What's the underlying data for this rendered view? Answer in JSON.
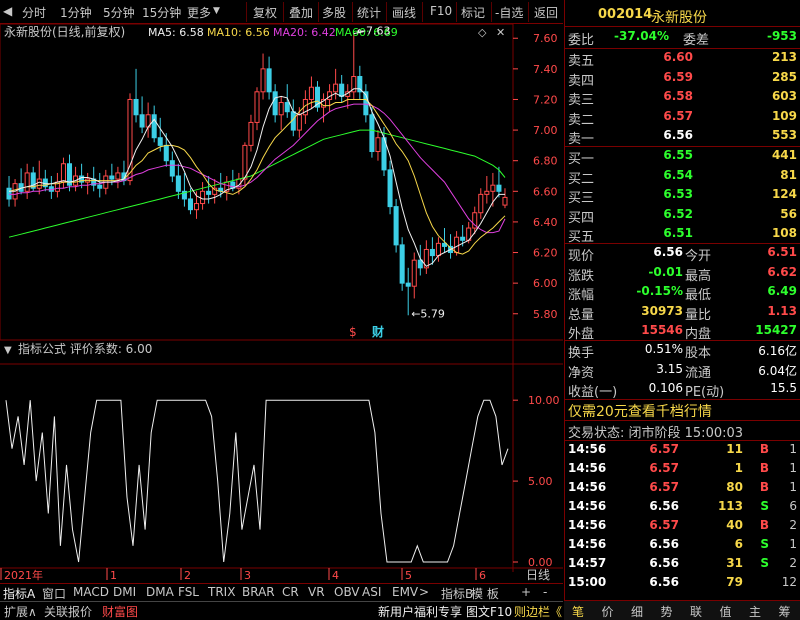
{
  "topbar": {
    "tabs": [
      "分时",
      "1分钟",
      "5分钟",
      "15分钟",
      "更多",
      "复权",
      "叠加",
      "多股",
      "统计",
      "画线",
      "F10",
      "标记",
      "-自选",
      "返回"
    ]
  },
  "chart_header": {
    "title": "永新股份(日线,前复权)",
    "ma5": "MA5: 6.58",
    "ma10": "MA10: 6.56",
    "ma20": "MA20: 6.42",
    "ma60": "MA60: 6.69",
    "high_label": "7.63",
    "low_label": "5.79",
    "fin_marker": "财",
    "dollar_marker": "$"
  },
  "price_axis": [
    "7.60",
    "7.40",
    "7.20",
    "7.00",
    "6.80",
    "6.60",
    "6.40",
    "6.20",
    "6.00",
    "5.80"
  ],
  "indicator": {
    "title": "指标公式 评价系数: 6.00",
    "axis": [
      "10.00",
      "5.00",
      "0.00"
    ]
  },
  "date_axis": {
    "labels": [
      "2021年",
      "1",
      "2",
      "3",
      "4",
      "5",
      "6"
    ],
    "right_label": "日线"
  },
  "bottom_tabs": [
    "指标A",
    "窗口",
    "MACD",
    "DMI",
    "DMA",
    "FSL",
    "TRIX",
    "BRAR",
    "CR",
    "VR",
    "OBV",
    "ASI",
    "EMV",
    ">",
    "指标B",
    "模 板",
    "+",
    "-"
  ],
  "status_bar": {
    "left": [
      "扩展∧",
      "关联报价",
      "财富图"
    ],
    "right": [
      "新用户福利专享",
      "图文F10",
      "则边栏《"
    ]
  },
  "quote": {
    "code": "002014",
    "name": "永新股份",
    "wb_label": "委比",
    "wb_val": "-37.04%",
    "wc_label": "委差",
    "wc_val": "-953",
    "asks": [
      {
        "label": "卖五",
        "price": "6.60",
        "vol": "213"
      },
      {
        "label": "卖四",
        "price": "6.59",
        "vol": "285"
      },
      {
        "label": "卖三",
        "price": "6.58",
        "vol": "603"
      },
      {
        "label": "卖二",
        "price": "6.57",
        "vol": "109"
      },
      {
        "label": "卖一",
        "price": "6.56",
        "vol": "553"
      }
    ],
    "bids": [
      {
        "label": "买一",
        "price": "6.55",
        "vol": "441"
      },
      {
        "label": "买二",
        "price": "6.54",
        "vol": "81"
      },
      {
        "label": "买三",
        "price": "6.53",
        "vol": "124"
      },
      {
        "label": "买四",
        "price": "6.52",
        "vol": "56"
      },
      {
        "label": "买五",
        "price": "6.51",
        "vol": "108"
      }
    ],
    "stats": [
      {
        "l1": "现价",
        "v1": "6.56",
        "l2": "今开",
        "v2": "6.51"
      },
      {
        "l1": "涨跌",
        "v1": "-0.01",
        "l2": "最高",
        "v2": "6.62"
      },
      {
        "l1": "涨幅",
        "v1": "-0.15%",
        "l2": "最低",
        "v2": "6.49"
      },
      {
        "l1": "总量",
        "v1": "30973",
        "l2": "量比",
        "v2": "1.13"
      },
      {
        "l1": "外盘",
        "v1": "15546",
        "l2": "内盘",
        "v2": "15427"
      }
    ],
    "stats2": [
      {
        "l1": "换手",
        "v1": "0.51%",
        "l2": "股本",
        "v2": "6.16亿"
      },
      {
        "l1": "净资",
        "v1": "3.15",
        "l2": "流通",
        "v2": "6.04亿"
      },
      {
        "l1": "收益(一)",
        "v1": "0.106",
        "l2": "PE(动)",
        "v2": "15.5"
      }
    ],
    "promo": "仅需20元查看千档行情",
    "trade_state": "交易状态: 闭市阶段  15:00:03",
    "ticks": [
      {
        "t": "14:56",
        "p": "6.57",
        "v": "11",
        "s": "B",
        "n": "1"
      },
      {
        "t": "14:56",
        "p": "6.57",
        "v": "1",
        "s": "B",
        "n": "1"
      },
      {
        "t": "14:56",
        "p": "6.57",
        "v": "80",
        "s": "B",
        "n": "1"
      },
      {
        "t": "14:56",
        "p": "6.56",
        "v": "113",
        "s": "S",
        "n": "6"
      },
      {
        "t": "14:56",
        "p": "6.57",
        "v": "40",
        "s": "B",
        "n": "2"
      },
      {
        "t": "14:56",
        "p": "6.56",
        "v": "6",
        "s": "S",
        "n": "1"
      },
      {
        "t": "14:57",
        "p": "6.56",
        "v": "31",
        "s": "S",
        "n": "2"
      },
      {
        "t": "15:00",
        "p": "6.56",
        "v": "79",
        "s": "",
        "n": "12"
      }
    ],
    "tabs": [
      "笔",
      "价",
      "细",
      "势",
      "联",
      "值",
      "主",
      "筹"
    ]
  },
  "chart_data": {
    "type": "candlestick",
    "ylim": [
      5.72,
      7.68
    ],
    "ohlc": [
      [
        6.62,
        6.7,
        6.5,
        6.55
      ],
      [
        6.55,
        6.68,
        6.5,
        6.65
      ],
      [
        6.65,
        6.75,
        6.58,
        6.6
      ],
      [
        6.6,
        6.78,
        6.55,
        6.72
      ],
      [
        6.72,
        6.76,
        6.6,
        6.62
      ],
      [
        6.62,
        6.8,
        6.58,
        6.68
      ],
      [
        6.68,
        6.74,
        6.6,
        6.63
      ],
      [
        6.63,
        6.7,
        6.55,
        6.6
      ],
      [
        6.6,
        6.72,
        6.56,
        6.66
      ],
      [
        6.66,
        6.82,
        6.62,
        6.78
      ],
      [
        6.78,
        6.84,
        6.6,
        6.64
      ],
      [
        6.64,
        6.76,
        6.6,
        6.7
      ],
      [
        6.7,
        6.78,
        6.62,
        6.66
      ],
      [
        6.66,
        6.72,
        6.58,
        6.68
      ],
      [
        6.68,
        6.76,
        6.6,
        6.64
      ],
      [
        6.64,
        6.72,
        6.56,
        6.62
      ],
      [
        6.62,
        6.74,
        6.58,
        6.7
      ],
      [
        6.7,
        6.78,
        6.64,
        6.68
      ],
      [
        6.68,
        6.76,
        6.62,
        6.72
      ],
      [
        6.72,
        6.8,
        6.64,
        6.67
      ],
      [
        6.67,
        7.24,
        6.64,
        7.2
      ],
      [
        7.2,
        7.4,
        7.05,
        7.1
      ],
      [
        7.1,
        7.22,
        6.98,
        7.02
      ],
      [
        7.02,
        7.18,
        6.95,
        7.1
      ],
      [
        7.1,
        7.16,
        6.92,
        6.95
      ],
      [
        6.95,
        7.08,
        6.86,
        6.9
      ],
      [
        6.9,
        6.98,
        6.76,
        6.8
      ],
      [
        6.8,
        6.86,
        6.66,
        6.7
      ],
      [
        6.7,
        6.78,
        6.55,
        6.6
      ],
      [
        6.6,
        6.72,
        6.5,
        6.55
      ],
      [
        6.55,
        6.62,
        6.45,
        6.48
      ],
      [
        6.48,
        6.6,
        6.42,
        6.52
      ],
      [
        6.52,
        6.66,
        6.48,
        6.6
      ],
      [
        6.6,
        6.7,
        6.52,
        6.58
      ],
      [
        6.58,
        6.68,
        6.52,
        6.62
      ],
      [
        6.62,
        6.72,
        6.56,
        6.6
      ],
      [
        6.6,
        6.7,
        6.54,
        6.66
      ],
      [
        6.66,
        6.74,
        6.6,
        6.62
      ],
      [
        6.62,
        6.72,
        6.58,
        6.68
      ],
      [
        6.68,
        6.92,
        6.64,
        6.9
      ],
      [
        6.9,
        7.1,
        6.86,
        7.05
      ],
      [
        7.05,
        7.28,
        7.0,
        7.25
      ],
      [
        7.25,
        7.5,
        7.2,
        7.4
      ],
      [
        7.4,
        7.48,
        7.2,
        7.25
      ],
      [
        7.25,
        7.3,
        7.05,
        7.1
      ],
      [
        7.1,
        7.22,
        7.0,
        7.18
      ],
      [
        7.18,
        7.3,
        7.08,
        7.12
      ],
      [
        7.12,
        7.2,
        6.96,
        7.0
      ],
      [
        7.0,
        7.15,
        6.95,
        7.1
      ],
      [
        7.1,
        7.26,
        7.04,
        7.2
      ],
      [
        7.2,
        7.35,
        7.14,
        7.28
      ],
      [
        7.28,
        7.32,
        7.12,
        7.15
      ],
      [
        7.15,
        7.24,
        7.05,
        7.2
      ],
      [
        7.2,
        7.3,
        7.12,
        7.25
      ],
      [
        7.25,
        7.4,
        7.2,
        7.3
      ],
      [
        7.3,
        7.36,
        7.18,
        7.22
      ],
      [
        7.22,
        7.3,
        7.14,
        7.25
      ],
      [
        7.25,
        7.63,
        7.2,
        7.35
      ],
      [
        7.35,
        7.42,
        7.2,
        7.25
      ],
      [
        7.25,
        7.3,
        7.05,
        7.1
      ],
      [
        7.1,
        7.15,
        6.82,
        6.86
      ],
      [
        6.86,
        7.0,
        6.8,
        6.95
      ],
      [
        6.95,
        7.02,
        6.7,
        6.74
      ],
      [
        6.74,
        6.8,
        6.45,
        6.5
      ],
      [
        6.5,
        6.55,
        6.2,
        6.25
      ],
      [
        6.25,
        6.3,
        5.95,
        6.0
      ],
      [
        6.0,
        6.1,
        5.79,
        5.98
      ],
      [
        5.98,
        6.2,
        5.9,
        6.15
      ],
      [
        6.15,
        6.25,
        6.05,
        6.1
      ],
      [
        6.1,
        6.28,
        6.06,
        6.22
      ],
      [
        6.22,
        6.3,
        6.12,
        6.18
      ],
      [
        6.18,
        6.3,
        6.14,
        6.26
      ],
      [
        6.26,
        6.36,
        6.2,
        6.24
      ],
      [
        6.24,
        6.32,
        6.16,
        6.2
      ],
      [
        6.2,
        6.34,
        6.18,
        6.3
      ],
      [
        6.3,
        6.38,
        6.24,
        6.28
      ],
      [
        6.28,
        6.4,
        6.26,
        6.36
      ],
      [
        6.36,
        6.5,
        6.32,
        6.46
      ],
      [
        6.46,
        6.62,
        6.42,
        6.58
      ],
      [
        6.58,
        6.7,
        6.52,
        6.6
      ],
      [
        6.6,
        6.72,
        6.5,
        6.64
      ],
      [
        6.64,
        6.76,
        6.56,
        6.6
      ],
      [
        6.51,
        6.62,
        6.49,
        6.56
      ]
    ],
    "ma5": [
      6.6,
      6.6,
      6.62,
      6.63,
      6.64,
      6.66,
      6.65,
      6.65,
      6.66,
      6.67,
      6.66,
      6.67,
      6.69,
      6.69,
      6.68,
      6.66,
      6.66,
      6.66,
      6.67,
      6.68,
      6.77,
      6.87,
      6.94,
      7.02,
      7.07,
      7.01,
      6.95,
      6.89,
      6.81,
      6.73,
      6.63,
      6.57,
      6.55,
      6.55,
      6.56,
      6.58,
      6.61,
      6.62,
      6.64,
      6.69,
      6.76,
      6.87,
      7.02,
      7.14,
      7.21,
      7.22,
      7.21,
      7.12,
      7.1,
      7.12,
      7.14,
      7.17,
      7.19,
      7.22,
      7.24,
      7.22,
      7.24,
      7.27,
      7.27,
      7.23,
      7.12,
      7.04,
      6.95,
      6.83,
      6.66,
      6.49,
      6.35,
      6.26,
      6.16,
      6.11,
      6.13,
      6.18,
      6.2,
      6.22,
      6.24,
      6.26,
      6.28,
      6.33,
      6.39,
      6.46,
      6.53,
      6.58,
      6.58
    ],
    "ma10": [
      6.6,
      6.61,
      6.62,
      6.63,
      6.63,
      6.64,
      6.64,
      6.65,
      6.65,
      6.66,
      6.66,
      6.66,
      6.67,
      6.67,
      6.67,
      6.67,
      6.67,
      6.67,
      6.67,
      6.68,
      6.72,
      6.77,
      6.8,
      6.85,
      6.87,
      6.89,
      6.9,
      6.9,
      6.89,
      6.87,
      6.82,
      6.76,
      6.71,
      6.65,
      6.61,
      6.6,
      6.59,
      6.58,
      6.6,
      6.63,
      6.68,
      6.74,
      6.82,
      6.89,
      6.95,
      6.99,
      7.03,
      7.07,
      7.12,
      7.16,
      7.18,
      7.19,
      7.16,
      7.16,
      7.18,
      7.18,
      7.2,
      7.2,
      7.2,
      7.2,
      7.16,
      7.1,
      7.04,
      6.98,
      6.91,
      6.86,
      6.8,
      6.7,
      6.58,
      6.46,
      6.37,
      6.31,
      6.27,
      6.23,
      6.2,
      6.19,
      6.21,
      6.26,
      6.3,
      6.33,
      6.36,
      6.4,
      6.44
    ],
    "ma20": [
      6.58,
      6.58,
      6.59,
      6.59,
      6.6,
      6.6,
      6.61,
      6.61,
      6.62,
      6.62,
      6.63,
      6.63,
      6.64,
      6.64,
      6.65,
      6.65,
      6.66,
      6.66,
      6.66,
      6.67,
      6.69,
      6.71,
      6.72,
      6.74,
      6.75,
      6.76,
      6.77,
      6.77,
      6.77,
      6.76,
      6.75,
      6.73,
      6.71,
      6.69,
      6.67,
      6.65,
      6.64,
      6.63,
      6.63,
      6.64,
      6.66,
      6.69,
      6.73,
      6.77,
      6.81,
      6.84,
      6.87,
      6.9,
      6.94,
      6.98,
      7.02,
      7.06,
      7.09,
      7.12,
      7.14,
      7.15,
      7.16,
      7.17,
      7.17,
      7.17,
      7.16,
      7.14,
      7.11,
      7.07,
      7.02,
      6.97,
      6.92,
      6.87,
      6.82,
      6.78,
      6.74,
      6.7,
      6.66,
      6.6,
      6.54,
      6.48,
      6.42,
      6.38,
      6.35,
      6.33,
      6.33,
      6.34,
      6.42
    ],
    "ma60": [
      6.3,
      6.31,
      6.32,
      6.33,
      6.34,
      6.35,
      6.36,
      6.37,
      6.38,
      6.39,
      6.4,
      6.41,
      6.42,
      6.43,
      6.44,
      6.45,
      6.46,
      6.47,
      6.48,
      6.49,
      6.5,
      6.51,
      6.52,
      6.53,
      6.54,
      6.55,
      6.56,
      6.57,
      6.58,
      6.59,
      6.6,
      6.61,
      6.62,
      6.63,
      6.64,
      6.65,
      6.66,
      6.67,
      6.68,
      6.69,
      6.7,
      6.72,
      6.74,
      6.76,
      6.78,
      6.8,
      6.82,
      6.84,
      6.86,
      6.88,
      6.9,
      6.92,
      6.94,
      6.95,
      6.96,
      6.97,
      6.98,
      6.99,
      7.0,
      7.0,
      7.0,
      6.99,
      6.98,
      6.97,
      6.96,
      6.95,
      6.94,
      6.93,
      6.92,
      6.91,
      6.9,
      6.89,
      6.88,
      6.87,
      6.86,
      6.85,
      6.84,
      6.83,
      6.81,
      6.79,
      6.77,
      6.74,
      6.69
    ],
    "indicator_ylim": [
      0,
      11
    ],
    "indicator_values": [
      10,
      7,
      9,
      6,
      10,
      5,
      8,
      3,
      9,
      1,
      6,
      2,
      0,
      4,
      8,
      10,
      10,
      10,
      10,
      10,
      4,
      1,
      6,
      2,
      8,
      10,
      10,
      10,
      10,
      10,
      10,
      10,
      10,
      10,
      9,
      5,
      0,
      3,
      8,
      2,
      4,
      6,
      2,
      10,
      10,
      10,
      10,
      10,
      10,
      10,
      10,
      10,
      10,
      10,
      10,
      10,
      10,
      10,
      10,
      10,
      10,
      8,
      3,
      0,
      0,
      0,
      0,
      0,
      1,
      0,
      0,
      0,
      0,
      0,
      1,
      3,
      5,
      7,
      9,
      10,
      10,
      9,
      6,
      7
    ]
  }
}
